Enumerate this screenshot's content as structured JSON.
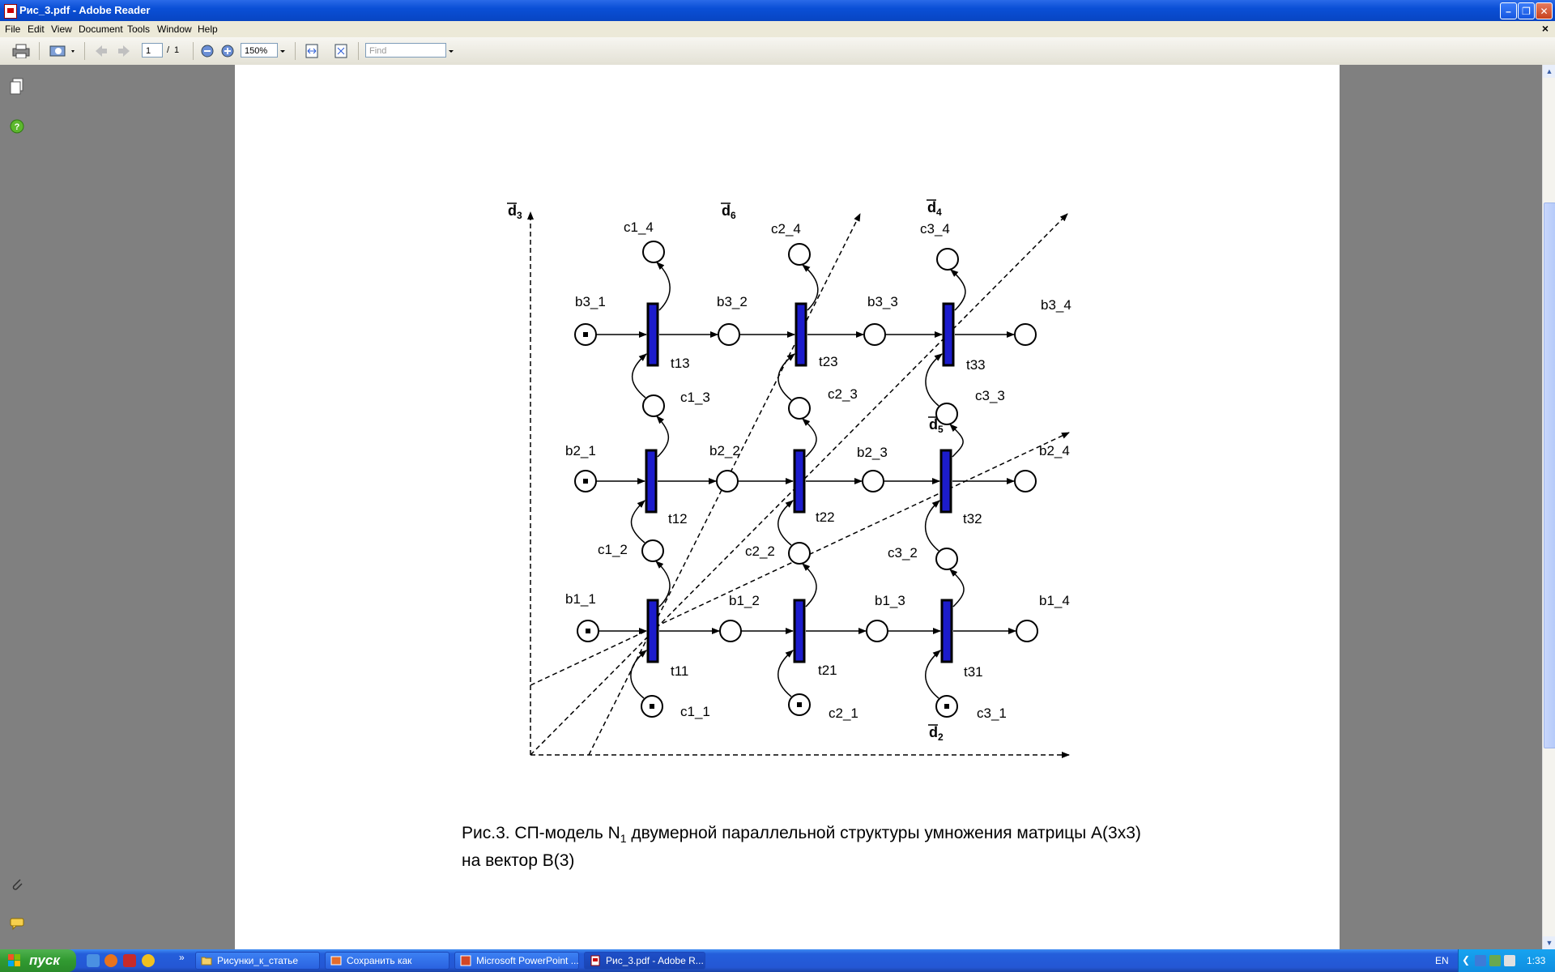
{
  "window": {
    "title": "Рис_3.pdf - Adobe Reader"
  },
  "menu": {
    "items": [
      "File",
      "Edit",
      "View",
      "Document",
      "Tools",
      "Window",
      "Help"
    ]
  },
  "toolbar": {
    "page_current": "1",
    "page_separator": "/",
    "page_total": "1",
    "zoom": "150%",
    "find_placeholder": "Find"
  },
  "diagram": {
    "axes": [
      "d",
      "d",
      "d",
      "d",
      "d"
    ],
    "axis_subscripts": [
      "3",
      "6",
      "4",
      "5",
      "2"
    ],
    "places": {
      "b3_1": "b3_1",
      "b3_2": "b3_2",
      "b3_3": "b3_3",
      "b3_4": "b3_4",
      "b2_1": "b2_1",
      "b2_2": "b2_2",
      "b2_3": "b2_3",
      "b2_4": "b2_4",
      "b1_1": "b1_1",
      "b1_2": "b1_2",
      "b1_3": "b1_3",
      "b1_4": "b1_4",
      "c1_1": "c1_1",
      "c1_2": "c1_2",
      "c1_3": "c1_3",
      "c1_4": "c1_4",
      "c2_1": "c2_1",
      "c2_2": "c2_2",
      "c2_3": "c2_3",
      "c2_4": "c2_4",
      "c3_1": "c3_1",
      "c3_2": "c3_2",
      "c3_3": "c3_3",
      "c3_4": "c3_4"
    },
    "transitions": {
      "t11": "t11",
      "t12": "t12",
      "t13": "t13",
      "t21": "t21",
      "t22": "t22",
      "t23": "t23",
      "t31": "t31",
      "t32": "t32",
      "t33": "t33"
    }
  },
  "caption": {
    "line1_prefix": "Рис.3. СП-модель  N",
    "line1_sub": "1",
    "line1_suffix": "  двумерной параллельной структуры умножения матрицы А(3х3)",
    "line2": "на вектор В(3)"
  },
  "taskbar": {
    "start_label": "пуск",
    "overflow": "»",
    "tasks": [
      "Рисунки_к_статье",
      "Сохранить как",
      "Microsoft PowerPoint ...",
      "Рис_3.pdf - Adobe R..."
    ],
    "language": "EN",
    "clock": "1:33"
  }
}
